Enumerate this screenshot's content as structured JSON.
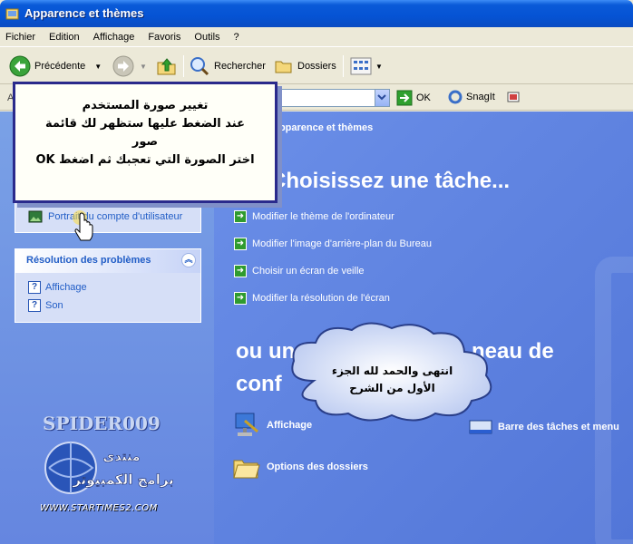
{
  "window": {
    "title": "Apparence et thèmes"
  },
  "menu": [
    "Fichier",
    "Edition",
    "Affichage",
    "Favoris",
    "Outils",
    "?"
  ],
  "toolbar": {
    "back_label": "Précédente",
    "search_label": "Rechercher",
    "folders_label": "Dossiers"
  },
  "address": {
    "label": "A",
    "go_label": "OK",
    "snagit_label": "SnagIt"
  },
  "left": {
    "user_picture_link": "Portrait du compte d'utilisateur",
    "troubleshoot": {
      "title": "Résolution des problèmes",
      "items": [
        "Affichage",
        "Son"
      ]
    }
  },
  "main": {
    "breadcrumb": "Apparence et thèmes",
    "heading_task": "Choisissez une tâche...",
    "tasks": [
      "Modifier le thème de l'ordinateur",
      "Modifier l'image d'arrière-plan du Bureau",
      "Choisir un écran de veille",
      "Modifier la résolution de l'écran"
    ],
    "heading_cp_line1": "ou un",
    "heading_cp_line1_end": "neau de",
    "heading_cp_line2": "conf",
    "cp_items": [
      "Affichage",
      "Barre des tâches et menu",
      "Options des dossiers"
    ]
  },
  "callout": {
    "lines": [
      "تغيير صورة المستخدم",
      "عند الضغط عليها ستظهر لك قائمة",
      "صور",
      "اختر الصورة التي تعجبك ثم اضغط OK"
    ]
  },
  "cloud": {
    "lines": [
      "انتهى والحمد لله  الجزء",
      "الأول من الشرح"
    ]
  },
  "branding": {
    "author": "SPIDER009",
    "forum_line1": "منتدى",
    "forum_line2": "برامج الكمبيوتر",
    "site": "WWW.STARTIMES2.COM"
  },
  "colors": {
    "xp_blue": "#0553d4",
    "task_pane_blue": "#6a8ee6",
    "link_blue": "#215dc6"
  }
}
